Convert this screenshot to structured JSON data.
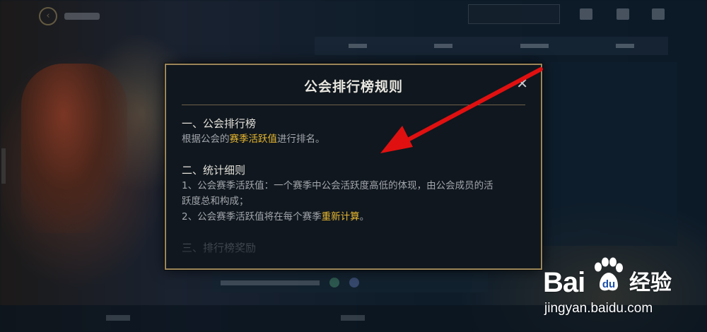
{
  "modal": {
    "title": "公会排行榜规则",
    "close_symbol": "✕",
    "sections": [
      {
        "heading": "一、公会排行榜",
        "lines": [
          {
            "before": "根据公会的",
            "highlight": "赛季活跃值",
            "after": "进行排名。"
          }
        ]
      },
      {
        "heading": "二、统计细则",
        "lines": [
          {
            "text": "1、公会赛季活跃值：一个赛季中公会活跃度高低的体现，由公会成员的活"
          },
          {
            "text": "跃度总和构成；"
          },
          {
            "before": "2、公会赛季活跃值将在每个赛季",
            "highlight": "重新计算",
            "after": "。"
          }
        ]
      },
      {
        "heading": "三、排行榜奖励"
      }
    ]
  },
  "watermark": {
    "logo_left": "Bai",
    "logo_right": "经验",
    "url": "jingyan.baidu.com"
  },
  "colors": {
    "modal_border": "#9c865a",
    "modal_bg": "#10171e",
    "highlight": "#e8b830",
    "arrow": "#e01010"
  }
}
